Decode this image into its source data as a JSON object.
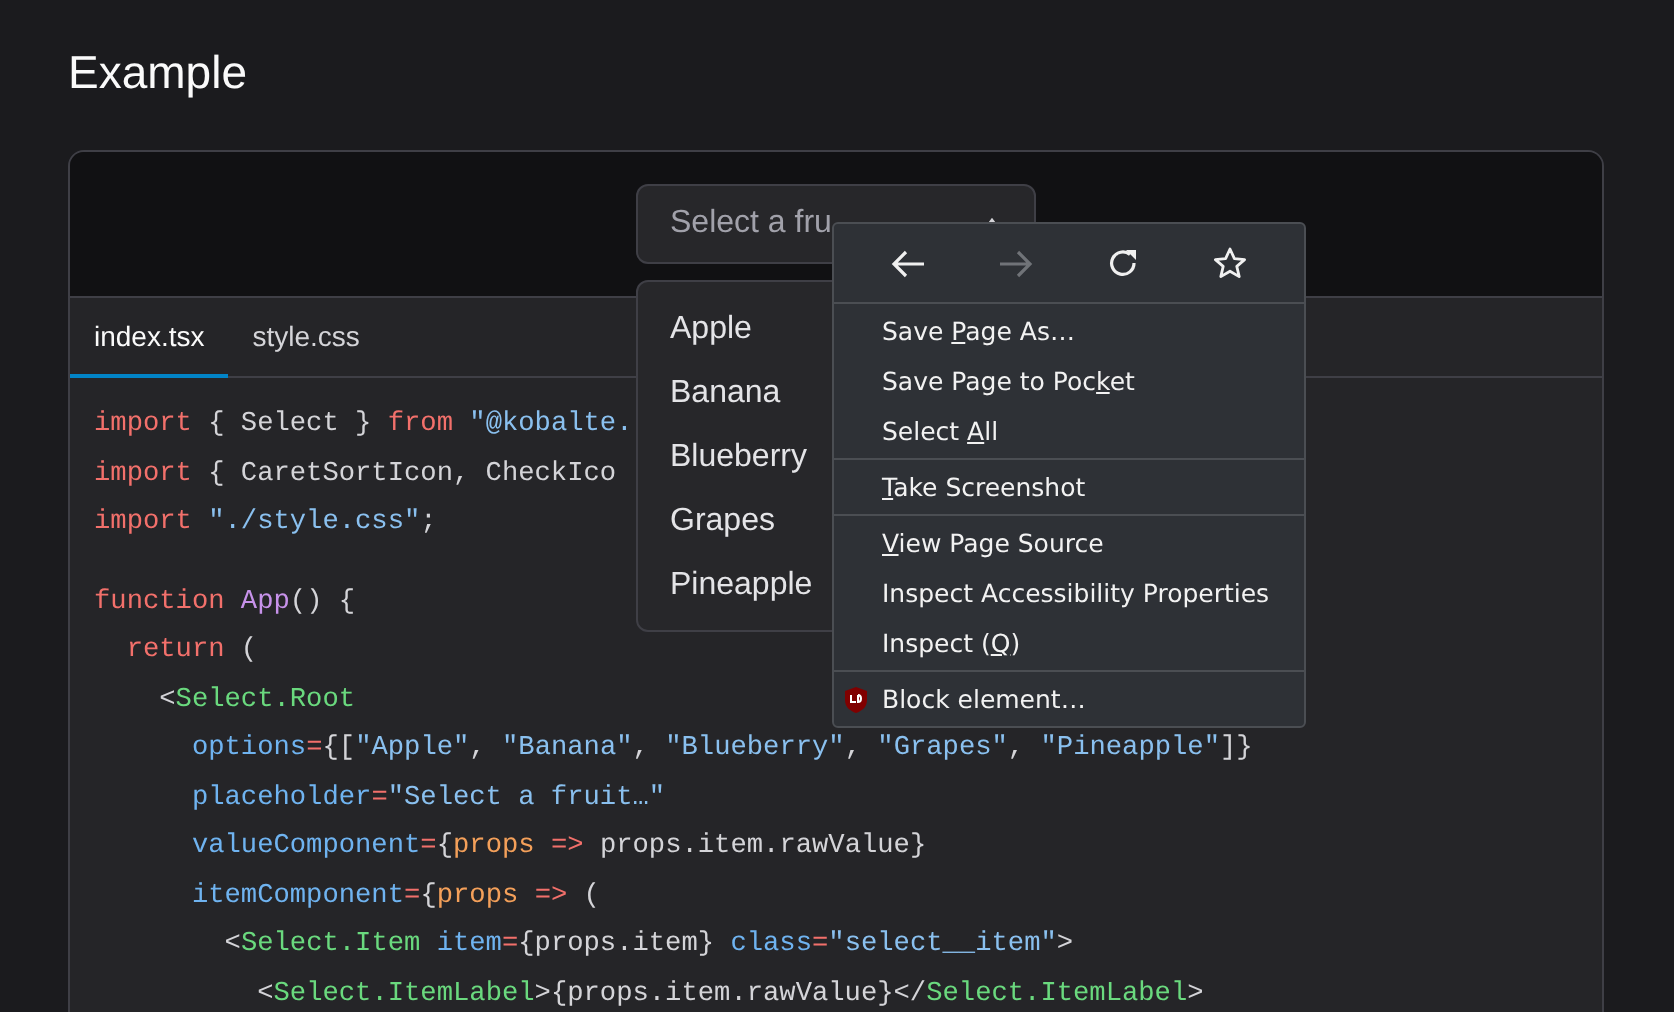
{
  "heading": "Example",
  "select": {
    "placeholder": "Select a fru",
    "options": [
      "Apple",
      "Banana",
      "Blueberry",
      "Grapes",
      "Pineapple"
    ]
  },
  "tabs": [
    {
      "label": "index.tsx",
      "selected": true
    },
    {
      "label": "style.css",
      "selected": false
    }
  ],
  "code_blocks": [
    [
      {
        "tokens": [
          {
            "kind": "keyword",
            "text": "import"
          },
          {
            "kind": "plain",
            "text": " { Select } "
          },
          {
            "kind": "keyword",
            "text": "from"
          },
          {
            "kind": "string",
            "text": " \"@kobalte."
          }
        ]
      },
      {
        "tokens": [
          {
            "kind": "keyword",
            "text": "import"
          },
          {
            "kind": "plain",
            "text": " { CaretSortIcon, CheckIco"
          }
        ]
      },
      {
        "tokens": [
          {
            "kind": "keyword",
            "text": "import"
          },
          {
            "kind": "string",
            "text": " \"./style.css\""
          },
          {
            "kind": "plain",
            "text": ";"
          }
        ]
      }
    ],
    [
      {
        "tokens": [
          {
            "kind": "keyword",
            "text": "function"
          },
          {
            "kind": "func",
            "text": " App"
          },
          {
            "kind": "plain",
            "text": "() {"
          }
        ],
        "children": [
          {
            "tokens": [
              {
                "kind": "keyword",
                "text": "return"
              },
              {
                "kind": "plain",
                "text": " ("
              }
            ],
            "children": [
              {
                "tokens": [
                  {
                    "kind": "plain",
                    "text": "<"
                  },
                  {
                    "kind": "tag",
                    "text": "Select.Root"
                  }
                ],
                "children": [
                  {
                    "tokens": [
                      {
                        "kind": "attr",
                        "text": "options"
                      },
                      {
                        "kind": "op",
                        "text": "="
                      },
                      {
                        "kind": "plain",
                        "text": "{["
                      },
                      {
                        "kind": "string",
                        "text": "\"Apple\""
                      },
                      {
                        "kind": "plain",
                        "text": ", "
                      },
                      {
                        "kind": "string",
                        "text": "\"Banana\""
                      },
                      {
                        "kind": "plain",
                        "text": ", "
                      },
                      {
                        "kind": "string",
                        "text": "\"Blueberry\""
                      },
                      {
                        "kind": "plain",
                        "text": ", "
                      },
                      {
                        "kind": "string",
                        "text": "\"Grapes\""
                      },
                      {
                        "kind": "plain",
                        "text": ", "
                      },
                      {
                        "kind": "string",
                        "text": "\"Pineapple\""
                      },
                      {
                        "kind": "plain",
                        "text": "]}"
                      }
                    ]
                  },
                  {
                    "tokens": [
                      {
                        "kind": "attr",
                        "text": "placeholder"
                      },
                      {
                        "kind": "op",
                        "text": "="
                      },
                      {
                        "kind": "string",
                        "text": "\"Select a fruit…\""
                      }
                    ]
                  },
                  {
                    "tokens": [
                      {
                        "kind": "attr",
                        "text": "valueComponent"
                      },
                      {
                        "kind": "op",
                        "text": "="
                      },
                      {
                        "kind": "plain",
                        "text": "{"
                      },
                      {
                        "kind": "param",
                        "text": "props"
                      },
                      {
                        "kind": "op",
                        "text": " =>"
                      },
                      {
                        "kind": "plain",
                        "text": " props.item.rawValue}"
                      }
                    ]
                  },
                  {
                    "tokens": [
                      {
                        "kind": "attr",
                        "text": "itemComponent"
                      },
                      {
                        "kind": "op",
                        "text": "="
                      },
                      {
                        "kind": "plain",
                        "text": "{"
                      },
                      {
                        "kind": "param",
                        "text": "props"
                      },
                      {
                        "kind": "op",
                        "text": " =>"
                      },
                      {
                        "kind": "plain",
                        "text": " ("
                      }
                    ],
                    "children": [
                      {
                        "tokens": [
                          {
                            "kind": "plain",
                            "text": "<"
                          },
                          {
                            "kind": "tag",
                            "text": "Select.Item"
                          },
                          {
                            "kind": "attr",
                            "text": " item"
                          },
                          {
                            "kind": "op",
                            "text": "="
                          },
                          {
                            "kind": "plain",
                            "text": "{props.item} "
                          },
                          {
                            "kind": "attr",
                            "text": "class"
                          },
                          {
                            "kind": "op",
                            "text": "="
                          },
                          {
                            "kind": "string",
                            "text": "\"select__item\""
                          },
                          {
                            "kind": "plain",
                            "text": ">"
                          }
                        ],
                        "children": [
                          {
                            "tokens": [
                              {
                                "kind": "plain",
                                "text": "<"
                              },
                              {
                                "kind": "tag",
                                "text": "Select.ItemLabel"
                              },
                              {
                                "kind": "plain",
                                "text": ">{props.item.rawValue}</"
                              },
                              {
                                "kind": "tag",
                                "text": "Select.ItemLabel"
                              },
                              {
                                "kind": "plain",
                                "text": ">"
                              }
                            ]
                          }
                        ]
                      }
                    ]
                  }
                ]
              }
            ]
          }
        ]
      }
    ]
  ],
  "context_menu": {
    "nav": [
      {
        "kind": "back",
        "disabled": false
      },
      {
        "kind": "forward",
        "disabled": true
      },
      {
        "kind": "reload",
        "disabled": false
      },
      {
        "kind": "bookmark",
        "disabled": false
      }
    ],
    "groups": [
      [
        {
          "before": "Save ",
          "key": "P",
          "after": "age As…"
        },
        {
          "before": "Save Page to Poc",
          "key": "k",
          "after": "et"
        },
        {
          "before": "Select ",
          "key": "A",
          "after": "ll"
        }
      ],
      [
        {
          "key": "T",
          "after": "ake Screenshot"
        }
      ],
      [
        {
          "key": "V",
          "after": "iew Page Source"
        },
        {
          "before": "Inspect Accessibility Properties"
        },
        {
          "before": "Inspect (",
          "key": "Q",
          "after": ")"
        }
      ],
      [
        {
          "before": "Block element…",
          "kind": "extension"
        }
      ]
    ]
  }
}
